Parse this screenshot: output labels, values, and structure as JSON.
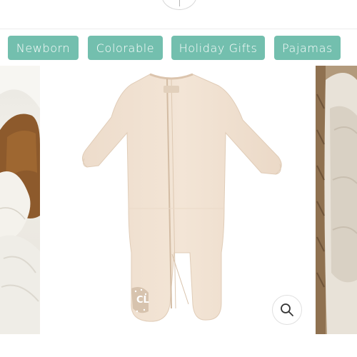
{
  "categories": [
    {
      "label": "Newborn"
    },
    {
      "label": "Colorable"
    },
    {
      "label": "Holiday Gifts"
    },
    {
      "label": "Pajamas"
    }
  ],
  "colors": {
    "tag_background": "#73bfae",
    "tag_text": "#ffffff",
    "garment": "#f1e3d4"
  },
  "product_image": {
    "garment_logo_text": "CL",
    "zoom_icon": "magnifier-icon"
  }
}
